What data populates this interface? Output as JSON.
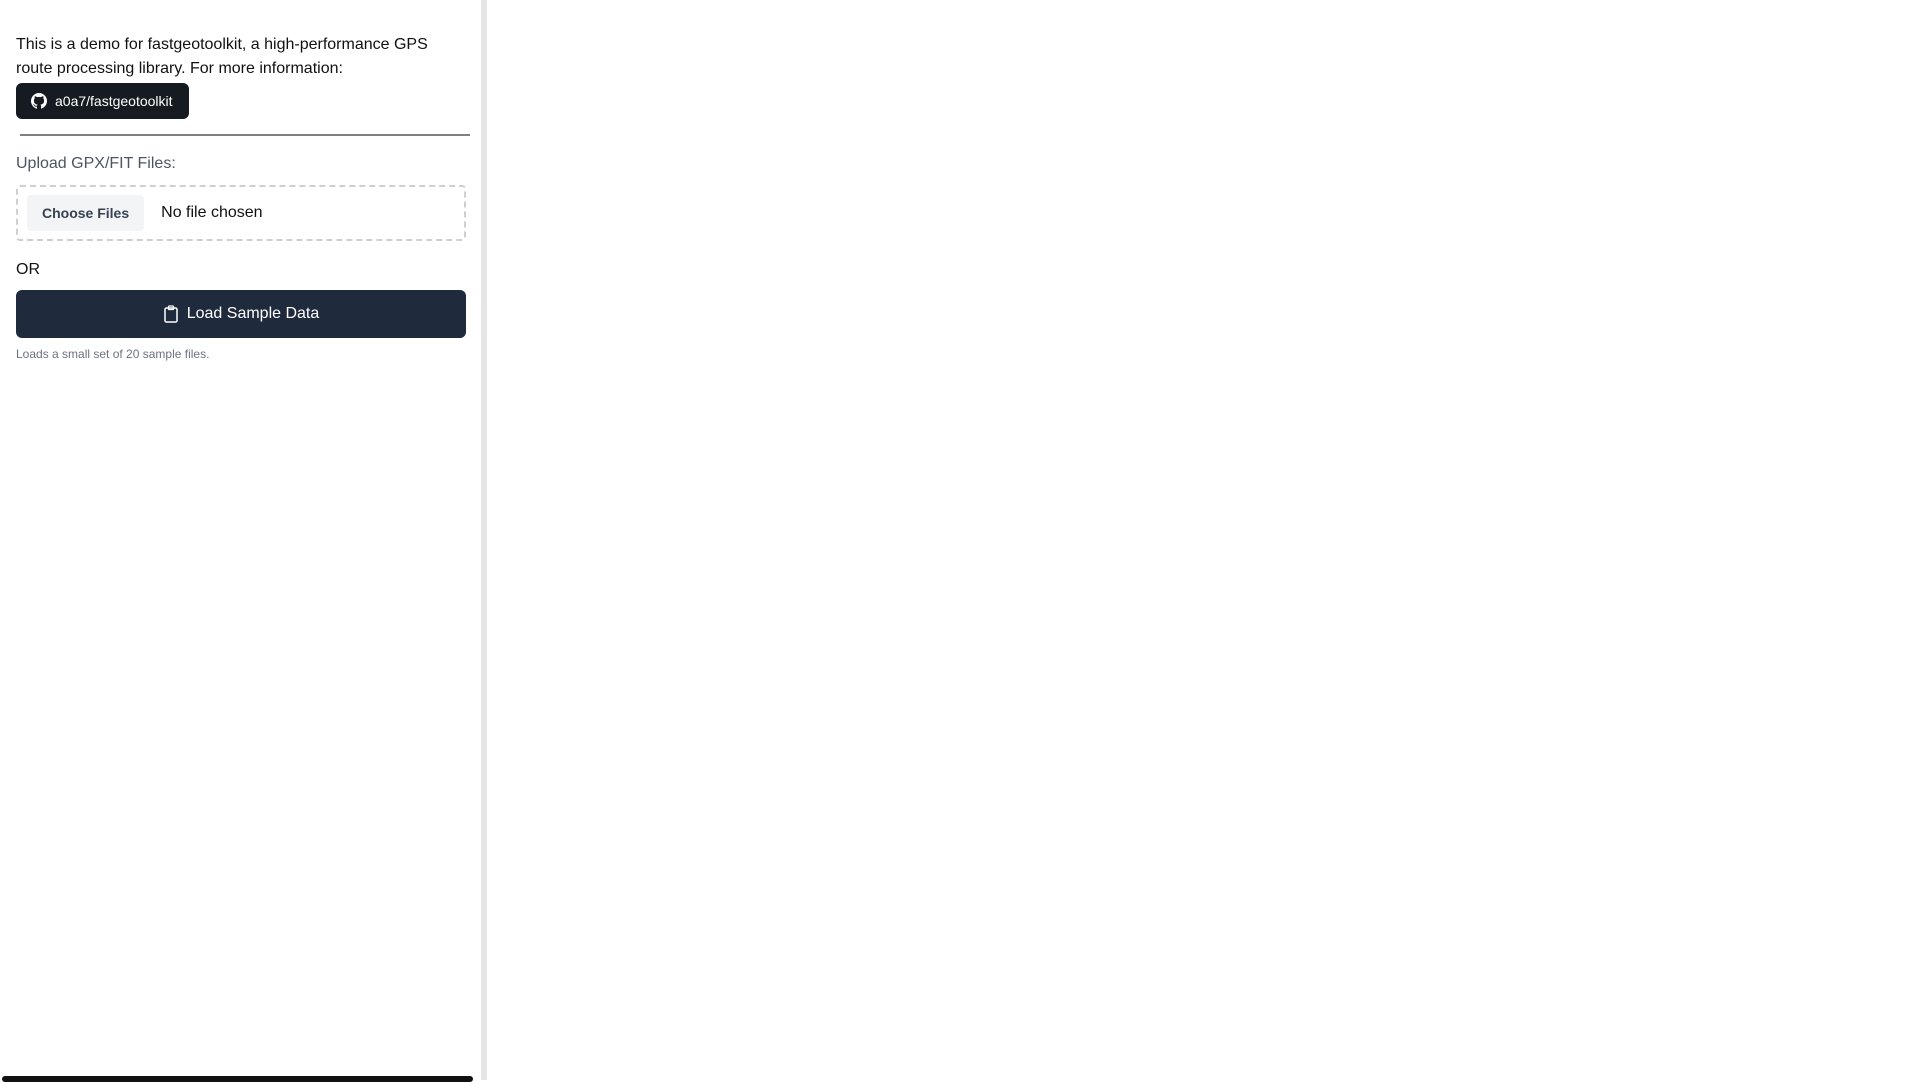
{
  "sidebar": {
    "intro_text": "This is a demo for fastgeotoolkit, a high-performance GPS route processing library. For more information:",
    "github_link": {
      "label": "a0a7/fastgeotoolkit",
      "icon": "github-icon"
    },
    "upload": {
      "label": "Upload GPX/FIT Files:",
      "choose_button": "Choose Files",
      "status": "No file chosen"
    },
    "or_text": "OR",
    "sample_button": {
      "label": "Load Sample Data",
      "icon": "clipboard-icon"
    },
    "sample_note": "Loads a small set of 20 sample files."
  },
  "colors": {
    "github_button_bg": "#161b22",
    "sample_button_bg": "#1f2a3c",
    "divider": "#808080",
    "resizer": "#e6e6e6"
  }
}
